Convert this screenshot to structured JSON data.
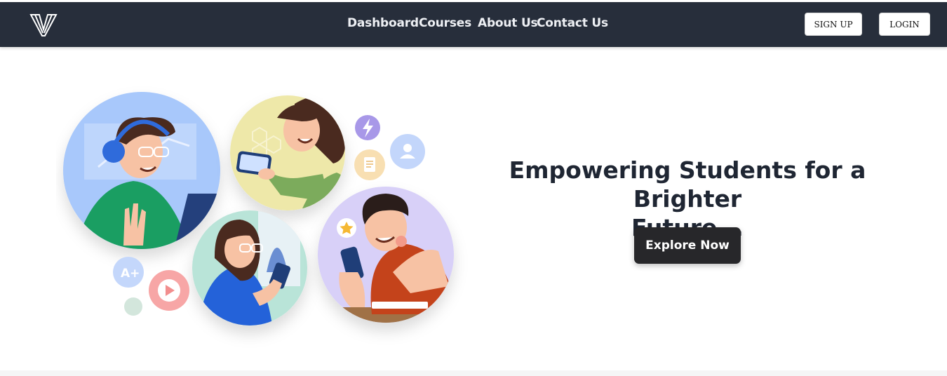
{
  "nav": {
    "logo_icon": "v-logo-icon",
    "links": [
      {
        "label": "Dashboard"
      },
      {
        "label": "Courses"
      },
      {
        "label": "About Us"
      },
      {
        "label": "Contact Us"
      }
    ],
    "signup_label": "SIGN UP",
    "login_label": "LOGIN"
  },
  "hero": {
    "title_line1": "Empowering Students for a Brighter",
    "title_line2": "Future...",
    "cta_label": "Explore Now",
    "illustration": {
      "badge_text": "A+",
      "icons": [
        "lightning-icon",
        "document-icon",
        "user-icon",
        "play-icon",
        "star-icon"
      ]
    }
  },
  "colors": {
    "navbar_bg": "#272e3b",
    "nav_text": "#eef0f4",
    "title_text": "#1f2633",
    "cta_bg": "#27272a"
  }
}
